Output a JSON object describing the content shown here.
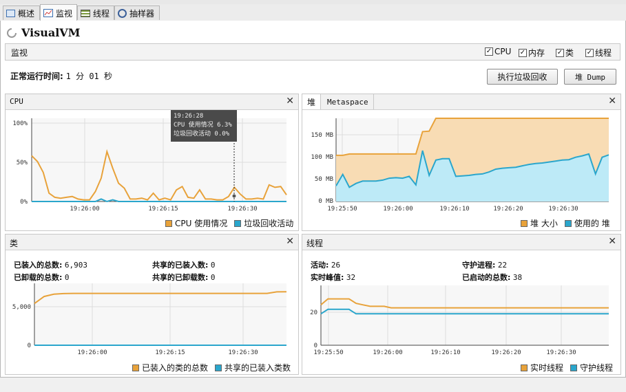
{
  "tabs": [
    {
      "label": "概述",
      "icon": "overview-icon"
    },
    {
      "label": "监视",
      "icon": "monitor-icon"
    },
    {
      "label": "线程",
      "icon": "threads-icon"
    },
    {
      "label": "抽样器",
      "icon": "sampler-icon"
    }
  ],
  "app_title": "VisualVM",
  "monitor": {
    "title": "监视",
    "checks": [
      {
        "label": "CPU",
        "checked": true
      },
      {
        "label": "内存",
        "checked": true
      },
      {
        "label": "类",
        "checked": true
      },
      {
        "label": "线程",
        "checked": true
      }
    ]
  },
  "uptime": {
    "label": "正常运行时间:",
    "value": "1 分 01 秒"
  },
  "buttons": {
    "gc": "执行垃圾回收",
    "heap_dump": "堆 Dump"
  },
  "cpu_panel": {
    "title": "CPU",
    "tooltip": {
      "time": "19:26:28",
      "cpu": "CPU 使用情况  6.3%",
      "gc": "垃圾回收活动  0.0%"
    },
    "legend": [
      "CPU 使用情况",
      "垃圾回收活动"
    ]
  },
  "heap_panel": {
    "tab_active": "堆",
    "tab_other": "Metaspace",
    "legend": [
      "堆 大小",
      "使用的 堆"
    ]
  },
  "classes_panel": {
    "title": "类",
    "stats": [
      {
        "label": "已装入的总数:",
        "value": "6,903"
      },
      {
        "label": "共享的已装入数:",
        "value": "0"
      },
      {
        "label": "已卸载的总数:",
        "value": "0"
      },
      {
        "label": "共享的已卸载数:",
        "value": "0"
      }
    ],
    "legend": [
      "已装入的类的总数",
      "共享的已装入类数"
    ]
  },
  "threads_panel": {
    "title": "线程",
    "stats": [
      {
        "label": "活动:",
        "value": "26"
      },
      {
        "label": "守护进程:",
        "value": "22"
      },
      {
        "label": "实时峰值:",
        "value": "32"
      },
      {
        "label": "已启动的总数:",
        "value": "38"
      }
    ],
    "legend": [
      "实时线程",
      "守护线程"
    ]
  },
  "colors": {
    "orange": "#e8a23a",
    "orange_fill": "#f8dcb4",
    "blue": "#2aa6cc",
    "blue_fill": "#bdeaf7"
  },
  "chart_data": [
    {
      "id": "cpu",
      "type": "line",
      "title": "CPU",
      "x_ticks": [
        "19:26:00",
        "19:26:15",
        "19:26:30"
      ],
      "y_ticks": [
        "100%",
        "50%",
        "0%"
      ],
      "ylim": [
        0,
        100
      ],
      "series": [
        {
          "name": "CPU 使用情况",
          "color": "#e8a23a",
          "values": [
            55,
            48,
            35,
            10,
            5,
            4,
            5,
            6,
            3,
            2,
            2,
            12,
            28,
            60,
            40,
            22,
            16,
            3,
            3,
            4,
            2,
            10,
            2,
            4,
            2,
            14,
            18,
            5,
            4,
            14,
            3,
            3,
            2,
            2,
            6,
            17,
            9,
            3,
            3,
            4,
            3,
            20,
            17,
            18,
            8
          ]
        },
        {
          "name": "垃圾回收活动",
          "color": "#2aa6cc",
          "values": [
            0,
            0,
            0,
            0,
            0,
            0,
            0,
            0,
            0,
            0,
            0,
            0,
            3,
            0,
            2,
            0,
            0,
            0,
            0,
            0,
            0,
            0,
            0,
            0,
            0,
            0,
            0,
            0,
            0,
            0,
            0,
            0,
            0,
            0,
            0,
            0,
            0,
            0,
            0,
            0,
            0,
            0,
            0,
            0,
            0
          ]
        }
      ]
    },
    {
      "id": "heap",
      "type": "area",
      "x_ticks": [
        "19:25:50",
        "19:26:00",
        "19:26:10",
        "19:26:20",
        "19:26:30"
      ],
      "y_ticks": [
        "150 MB",
        "100 MB",
        "50 MB",
        "0 MB"
      ],
      "ylim": [
        0,
        175
      ],
      "series": [
        {
          "name": "堆 大小",
          "color": "#e8a23a",
          "values": [
            97,
            97,
            100,
            100,
            100,
            100,
            100,
            100,
            100,
            100,
            100,
            100,
            100,
            147,
            148,
            175,
            175,
            175,
            175,
            175,
            175,
            175,
            175,
            175,
            175,
            175,
            175,
            175,
            175,
            175,
            175,
            175,
            175,
            175,
            175,
            175,
            175,
            175,
            175,
            175,
            175,
            175
          ]
        },
        {
          "name": "使用的 堆",
          "color": "#2aa6cc",
          "values": [
            33,
            57,
            30,
            38,
            43,
            43,
            43,
            45,
            49,
            50,
            49,
            53,
            35,
            107,
            55,
            87,
            90,
            90,
            53,
            54,
            55,
            57,
            58,
            62,
            68,
            70,
            71,
            72,
            75,
            78,
            80,
            81,
            83,
            85,
            87,
            88,
            93,
            96,
            100,
            58,
            93,
            98
          ]
        }
      ]
    },
    {
      "id": "classes",
      "type": "line",
      "x_ticks": [
        "19:26:00",
        "19:26:15",
        "19:26:30"
      ],
      "y_ticks": [
        "5,000",
        "0"
      ],
      "ylim": [
        0,
        8000
      ],
      "series": [
        {
          "name": "已装入的类的总数",
          "color": "#e8a23a",
          "values": [
            5400,
            6300,
            6600,
            6680,
            6700,
            6700,
            6700,
            6700,
            6700,
            6700,
            6700,
            6700,
            6700,
            6700,
            6700,
            6700,
            6700,
            6700,
            6700,
            6700,
            6700,
            6700,
            6700,
            6700,
            6700,
            6900,
            6903
          ]
        },
        {
          "name": "共享的已装入类数",
          "color": "#2aa6cc",
          "values": [
            0,
            0,
            0,
            0,
            0,
            0,
            0,
            0,
            0,
            0,
            0,
            0,
            0,
            0,
            0,
            0,
            0,
            0,
            0,
            0,
            0,
            0,
            0,
            0,
            0,
            0,
            0
          ]
        }
      ]
    },
    {
      "id": "threads",
      "type": "line",
      "x_ticks": [
        "19:25:50",
        "19:26:00",
        "19:26:10",
        "19:26:20",
        "19:26:30"
      ],
      "y_ticks": [
        "20",
        "0"
      ],
      "ylim": [
        0,
        40
      ],
      "series": [
        {
          "name": "实时线程",
          "color": "#e8a23a",
          "values": [
            27,
            31,
            31,
            31,
            31,
            28,
            27,
            26,
            26,
            26,
            25,
            25,
            25,
            25,
            25,
            25,
            25,
            25,
            25,
            25,
            25,
            25,
            25,
            25,
            25,
            25,
            25,
            25,
            25,
            25,
            25,
            25,
            25,
            25,
            25,
            25,
            25,
            25,
            25,
            25,
            25,
            25
          ]
        },
        {
          "name": "守护线程",
          "color": "#2aa6cc",
          "values": [
            21,
            24,
            24,
            24,
            24,
            21,
            21,
            21,
            21,
            21,
            21,
            21,
            21,
            21,
            21,
            21,
            21,
            21,
            21,
            21,
            21,
            21,
            21,
            21,
            21,
            21,
            21,
            21,
            21,
            21,
            21,
            21,
            21,
            21,
            21,
            21,
            21,
            21,
            21,
            21,
            21,
            21
          ]
        }
      ]
    }
  ]
}
